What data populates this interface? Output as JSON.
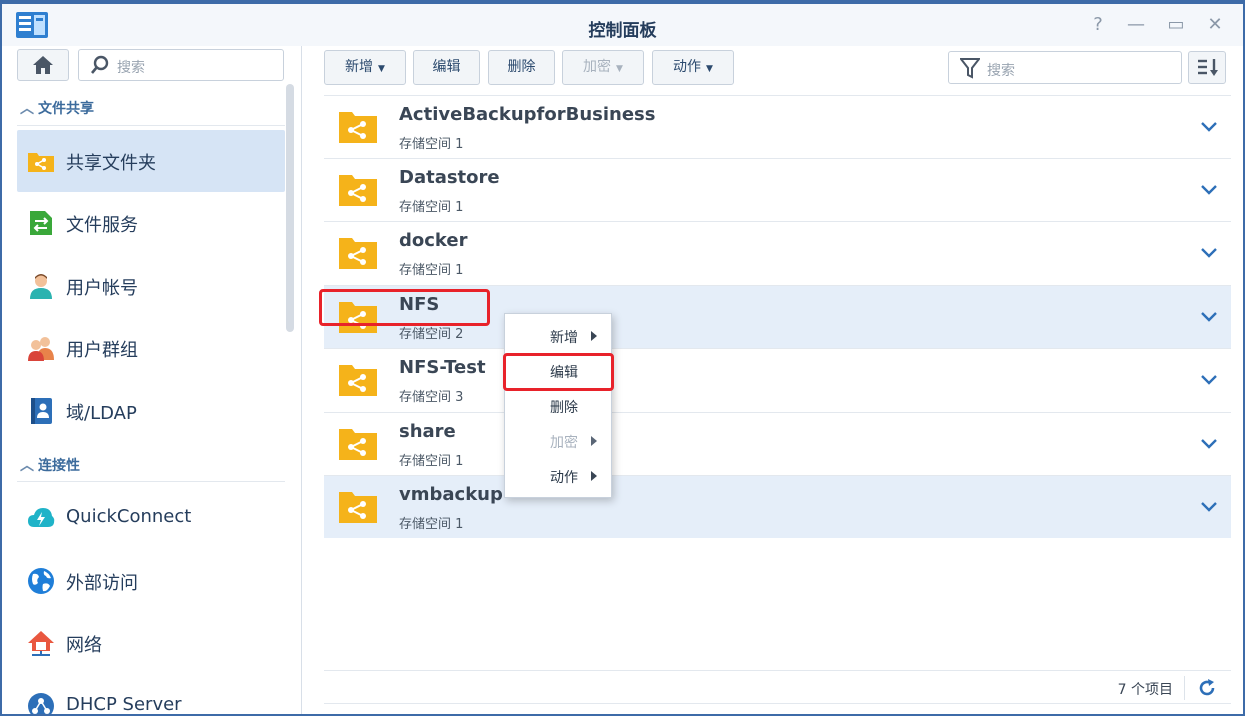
{
  "window": {
    "title": "控制面板",
    "controls": {
      "help": "?",
      "minimize": "—",
      "maximize": "▭",
      "close": "✕"
    }
  },
  "sidebar": {
    "search_placeholder": "搜索",
    "sections": [
      {
        "label": "文件共享",
        "items": [
          {
            "label": "共享文件夹",
            "icon": "shared-folder-icon",
            "active": true
          },
          {
            "label": "文件服务",
            "icon": "file-services-icon"
          },
          {
            "label": "用户帐号",
            "icon": "user-icon"
          },
          {
            "label": "用户群组",
            "icon": "group-icon"
          },
          {
            "label": "域/LDAP",
            "icon": "domain-ldap-icon"
          }
        ]
      },
      {
        "label": "连接性",
        "items": [
          {
            "label": "QuickConnect",
            "icon": "quickconnect-icon"
          },
          {
            "label": "外部访问",
            "icon": "globe-icon"
          },
          {
            "label": "网络",
            "icon": "network-icon"
          },
          {
            "label": "DHCP Server",
            "icon": "dhcp-server-icon"
          }
        ]
      }
    ]
  },
  "toolbar": {
    "create": "新增",
    "edit": "编辑",
    "delete": "删除",
    "encrypt": "加密",
    "action": "动作",
    "search_placeholder": "搜索"
  },
  "folders": [
    {
      "name": "ActiveBackupforBusiness",
      "volume": "存储空间 1"
    },
    {
      "name": "Datastore",
      "volume": "存储空间 1"
    },
    {
      "name": "docker",
      "volume": "存储空间 1"
    },
    {
      "name": "NFS",
      "volume": "存储空间 2",
      "selected": true
    },
    {
      "name": "NFS-Test",
      "volume": "存储空间 3"
    },
    {
      "name": "share",
      "volume": "存储空间 1"
    },
    {
      "name": "vmbackup",
      "volume": "存储空间 1"
    }
  ],
  "footer": {
    "count": "7 个项目"
  },
  "context_menu": {
    "items": [
      {
        "label": "新增",
        "submenu": true
      },
      {
        "label": "编辑",
        "submenu": false,
        "highlighted": true
      },
      {
        "label": "删除",
        "submenu": false
      },
      {
        "label": "加密",
        "submenu": true,
        "disabled": true
      },
      {
        "label": "动作",
        "submenu": true
      }
    ]
  },
  "colors": {
    "accent": "#3c6b9c",
    "folder": "#f5b31a",
    "highlight_box": "#e8222a",
    "selected_row": "#e5eef9"
  }
}
